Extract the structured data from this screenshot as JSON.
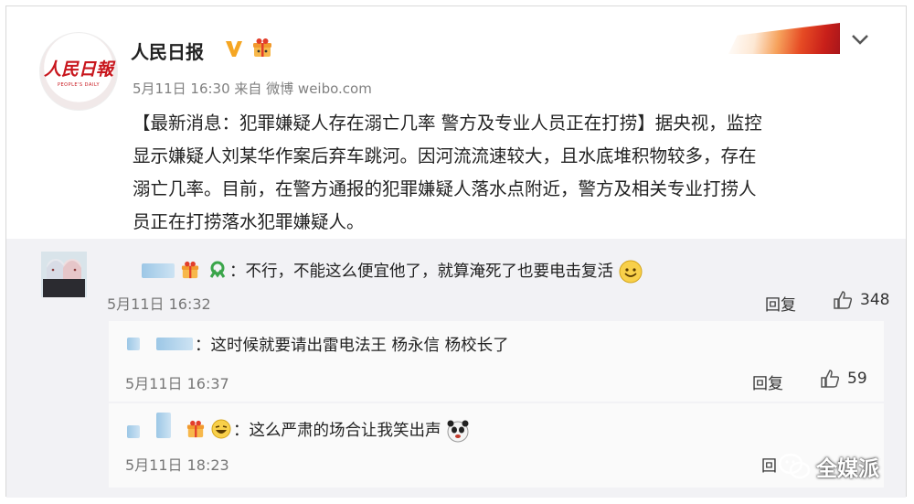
{
  "post": {
    "username": "人民日报",
    "avatar_logo": "人民日報",
    "avatar_sub": "PEOPLE'S DAILY",
    "meta": "5月11日 16:30 来自 微博 weibo.com",
    "body_line1": "【最新消息：犯罪嫌疑人存在溺亡几率 警方及专业人员正在打捞】据央视，监控",
    "body_line2": "显示嫌疑人刘某华作案后弃车跳河。因河流流速较大，且水底堆积物较多，存在",
    "body_line3": "溺亡几率。目前，在警方通报的犯罪嫌疑人落水点附近，警方及相关专业打捞人",
    "body_line4": "员正在打捞落水犯罪嫌疑人。",
    "icons": [
      "verified-v-icon",
      "gift-badge-icon",
      "chevron-down-icon"
    ],
    "colors": {
      "brand_red": "#c8161d",
      "verified_orange": "#f5a623"
    }
  },
  "comments": [
    {
      "text": "：不行，不能这么便宜他了，就算淹死了也要电击复活",
      "time": "5月11日 16:32",
      "reply": "回复",
      "likes": "348"
    },
    {
      "text": "：这时候就要请出雷电法王  杨永信  杨校长了",
      "time": "5月11日 16:37",
      "reply": "回复",
      "likes": "59"
    },
    {
      "text": "：这么严肃的场合让我笑出声",
      "time": "5月11日 18:23",
      "reply": "回"
    }
  ],
  "watermark": "全媒派"
}
